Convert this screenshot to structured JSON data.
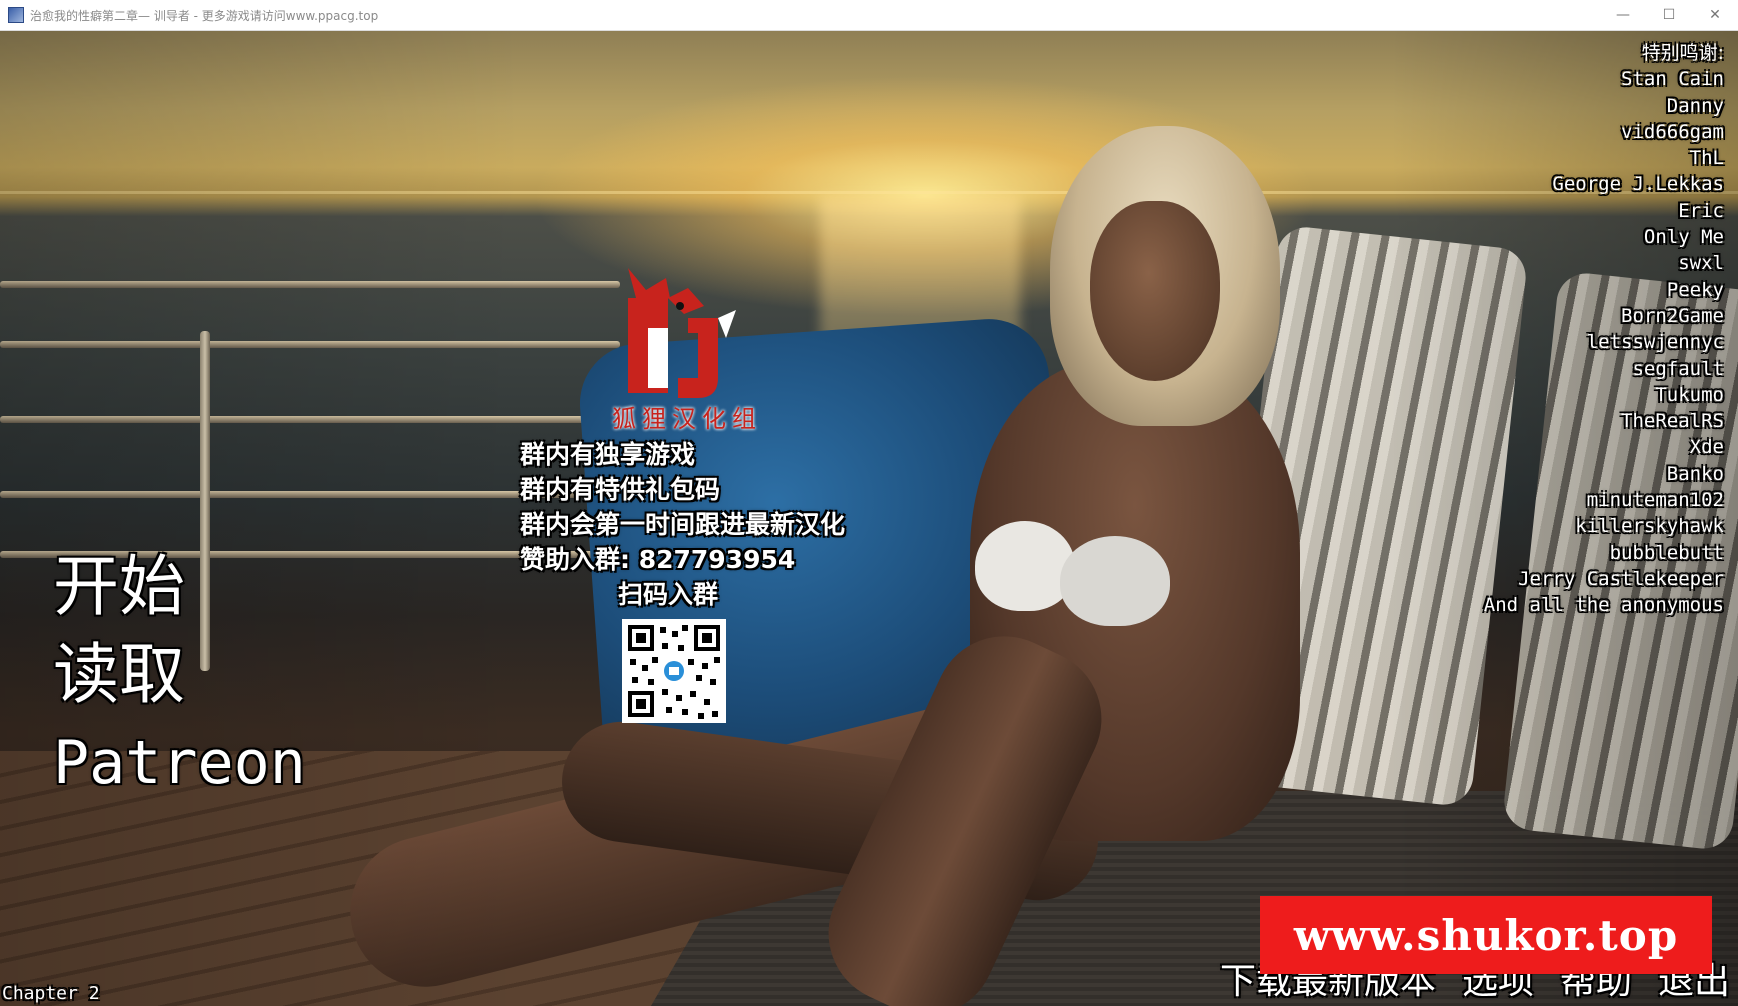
{
  "window": {
    "title": "治愈我的性癖第二章— 训导者 - 更多游戏请访问www.ppacg.top",
    "controls": {
      "minimize": "—",
      "maximize": "☐",
      "close": "✕"
    }
  },
  "main_menu": {
    "start": "开始",
    "load": "读取",
    "patreon": "Patreon"
  },
  "credits": {
    "heading": "特别鸣谢:",
    "names": [
      "Stan Cain",
      "Danny",
      "vid666gam",
      "ThL",
      "George J.Lekkas",
      "Eric",
      "Only Me",
      "swxl",
      "Peeky",
      "Born2Game",
      "letsswjennyc",
      "segfault",
      "Tukumo",
      "TheRealRS",
      "Xde",
      "Banko",
      "minuteman102",
      "killerskyhawk",
      "bubblebutt",
      "Jerry Castlekeeper",
      "And all the anonymous"
    ]
  },
  "promo": {
    "logo_text": "狐狸汉化组",
    "line1": "群内有独享游戏",
    "line2": "群内有特供礼包码",
    "line3": "群内会第一时间跟进最新汉化",
    "line4": "赞助入群: 827793954",
    "line5": "扫码入群"
  },
  "bottom_menu": {
    "download": "下载最新版本",
    "options": "选项",
    "help": "帮助",
    "quit": "退出"
  },
  "version_label": "Chapter 2",
  "watermark_banner": "www.shukor.top",
  "colors": {
    "banner_red": "#ee1c1c",
    "logo_red": "#c8231d",
    "text_white": "#ffffff"
  }
}
